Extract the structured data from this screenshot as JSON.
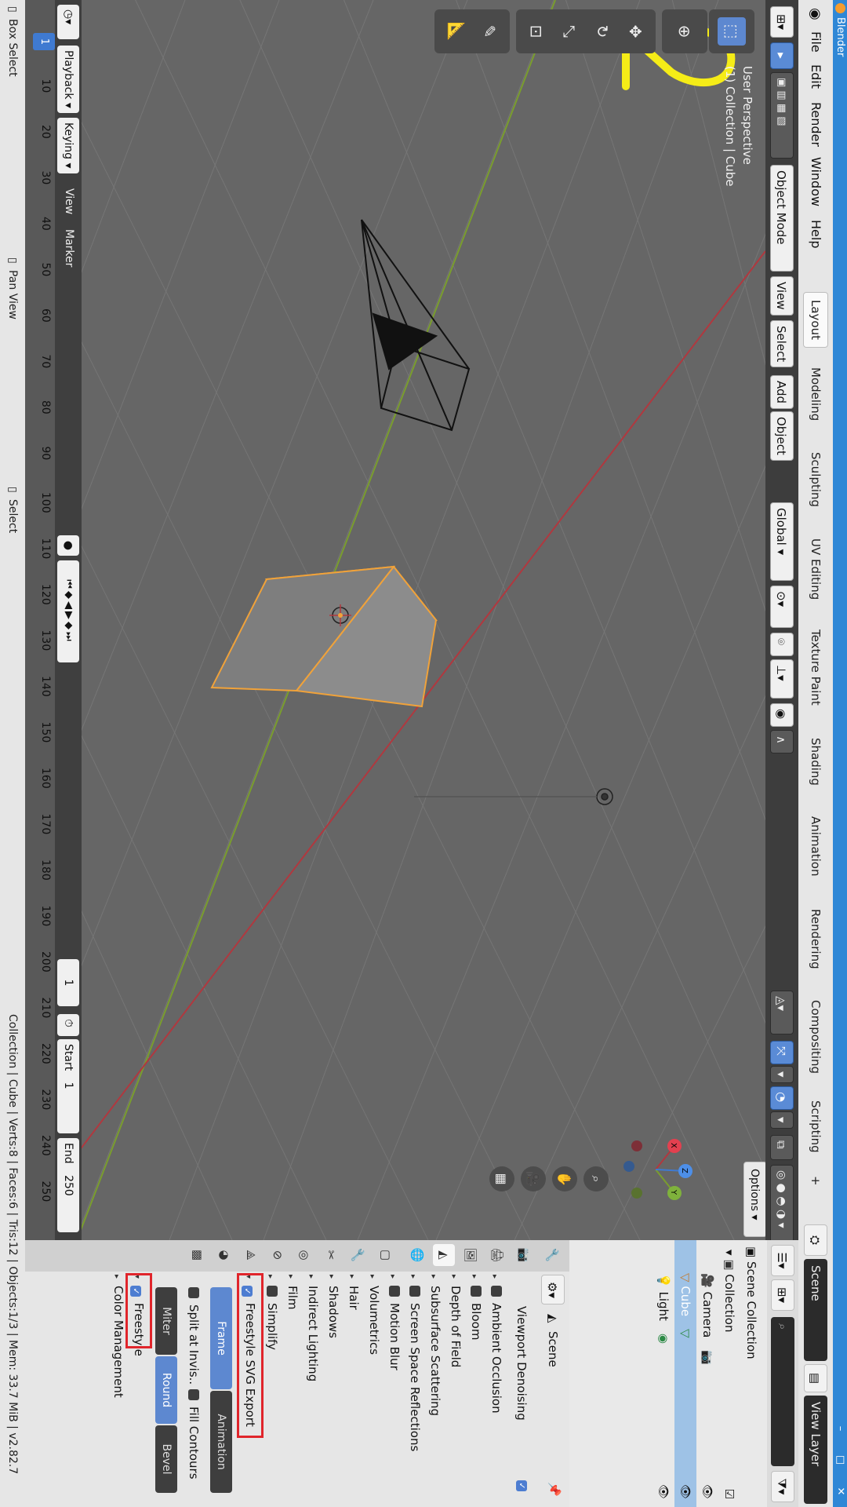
{
  "window": {
    "title": "Blender",
    "minimize": "–",
    "maximize": "□",
    "close": "✕"
  },
  "menus": [
    "File",
    "Edit",
    "Render",
    "Window",
    "Help"
  ],
  "workspaces": [
    "Layout",
    "Modeling",
    "Sculpting",
    "UV Editing",
    "Texture Paint",
    "Shading",
    "Animation",
    "Rendering",
    "Compositing",
    "Scripting",
    "+"
  ],
  "scene_field": "Scene",
  "view_layer_field": "View Layer",
  "viewport_header": {
    "mode": "Object Mode",
    "menus": [
      "View",
      "Select",
      "Add",
      "Object"
    ],
    "orientation": "Global",
    "options": "Options"
  },
  "viewport": {
    "perspective": "User Perspective",
    "collection_info": "(1) Collection | Cube",
    "annotation": "2",
    "colors": {
      "x_axis": "#b0383f",
      "y_axis": "#7a9d2e",
      "selection": "#f0a23a",
      "annotation": "#f5ec17"
    }
  },
  "timeline": {
    "menus": [
      "Playback",
      "Keying",
      "View",
      "Marker"
    ],
    "frame_numbers": [
      "1",
      "10",
      "20",
      "30",
      "40",
      "50",
      "60",
      "70",
      "80",
      "90",
      "100",
      "110",
      "120",
      "130",
      "140",
      "150",
      "160",
      "170",
      "180",
      "190",
      "200",
      "210",
      "220",
      "230",
      "240",
      "250"
    ],
    "current_frame": "1",
    "start_label": "Start",
    "start_value": "1",
    "end_label": "End",
    "end_value": "250"
  },
  "statusbar": {
    "box_select": "Box Select",
    "pan_view": "Pan View",
    "select": "Select",
    "stats": "Collection | Cube | Verts:8 | Faces:6 | Tris:12 | Objects:1/3 | Mem: 33.7 MiB | v2.82.7"
  },
  "outliner": {
    "scene_collection": "Scene Collection",
    "items": [
      "Collection",
      "Camera",
      "Cube",
      "Light"
    ]
  },
  "properties": {
    "context": "Scene",
    "viewport_denoising": "Viewport Denoising",
    "panels": [
      "Ambient Occlusion",
      "Bloom",
      "Depth of Field",
      "Subsurface Scattering",
      "Screen Space Reflections",
      "Motion Blur",
      "Volumetrics",
      "Hair",
      "Shadows",
      "Indirect Lighting",
      "Film",
      "Simplify"
    ],
    "svg_export": "Freestyle SVG Export",
    "svg_mode": [
      "Frame",
      "Animation"
    ],
    "split_invisible": "Split at Invis..",
    "fill_contours": "Fill Contours",
    "join": [
      "Miter",
      "Round",
      "Bevel"
    ],
    "freestyle": "Freestyle",
    "color_management": "Color Management"
  }
}
